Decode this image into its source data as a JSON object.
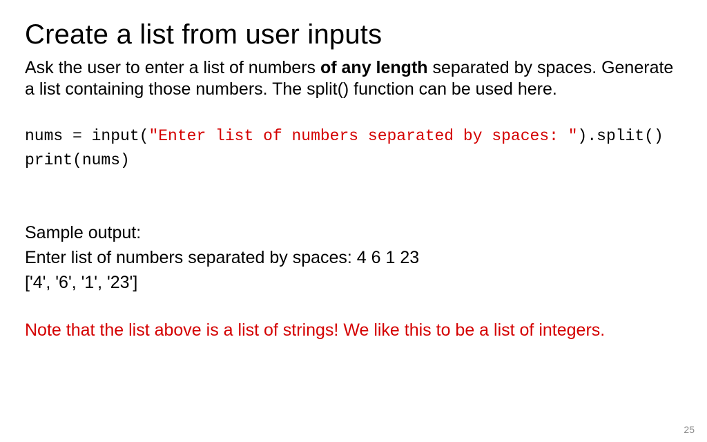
{
  "title": "Create a list from user inputs",
  "desc": {
    "part1": " Ask the user to enter a list of numbers ",
    "bold": "of any length",
    "part2": " separated by spaces. Generate a list containing those numbers. The split() function can be used here."
  },
  "code": {
    "line1_pre": "nums = input(",
    "line1_str": "\"Enter list of numbers separated by spaces: \"",
    "line1_post": ").split()",
    "line2": "print(nums)"
  },
  "sample": {
    "label": "Sample output:",
    "line1": "Enter list of numbers separated by spaces: 4 6 1 23",
    "line2": "['4', '6', '1', '23']"
  },
  "note": "Note that the list above is a list of strings! We like this to be a list of integers.",
  "page": "25"
}
